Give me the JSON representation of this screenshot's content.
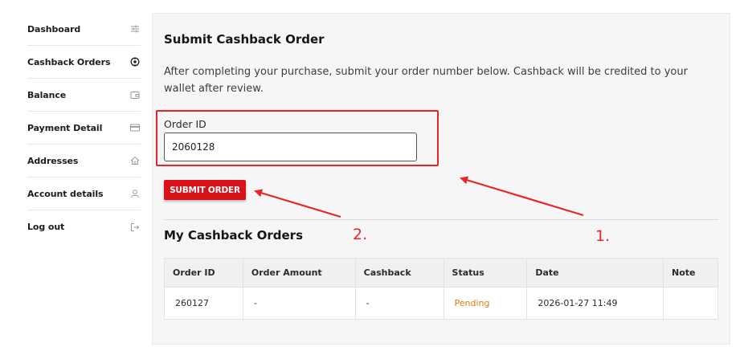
{
  "sidebar": {
    "items": [
      {
        "label": "Dashboard",
        "icon": "sliders-icon"
      },
      {
        "label": "Cashback Orders",
        "icon": "cashback-icon"
      },
      {
        "label": "Balance",
        "icon": "wallet-icon"
      },
      {
        "label": "Payment Detail",
        "icon": "card-icon"
      },
      {
        "label": "Addresses",
        "icon": "home-icon"
      },
      {
        "label": "Account details",
        "icon": "user-icon"
      },
      {
        "label": "Log out",
        "icon": "logout-icon"
      }
    ]
  },
  "main": {
    "title": "Submit Cashback Order",
    "description": "After completing your purchase, submit your order number below. Cashback will be credited to your wallet after review.",
    "order_id_label": "Order ID",
    "order_id_value": "2060128",
    "submit_label": "SUBMIT ORDER",
    "orders_title": "My Cashback Orders",
    "table": {
      "headers": [
        "Order ID",
        "Order Amount",
        "Cashback",
        "Status",
        "Date",
        "Note"
      ],
      "rows": [
        {
          "order_id": "260127",
          "amount": "-",
          "cashback": "-",
          "status": "Pending",
          "date": "2026-01-27 11:49",
          "note": ""
        }
      ]
    }
  },
  "annotations": {
    "label_1": "1.",
    "label_2": "2.",
    "color": "#e8262a"
  },
  "colors": {
    "accent": "#d8111b",
    "pending": "#e07a12"
  }
}
